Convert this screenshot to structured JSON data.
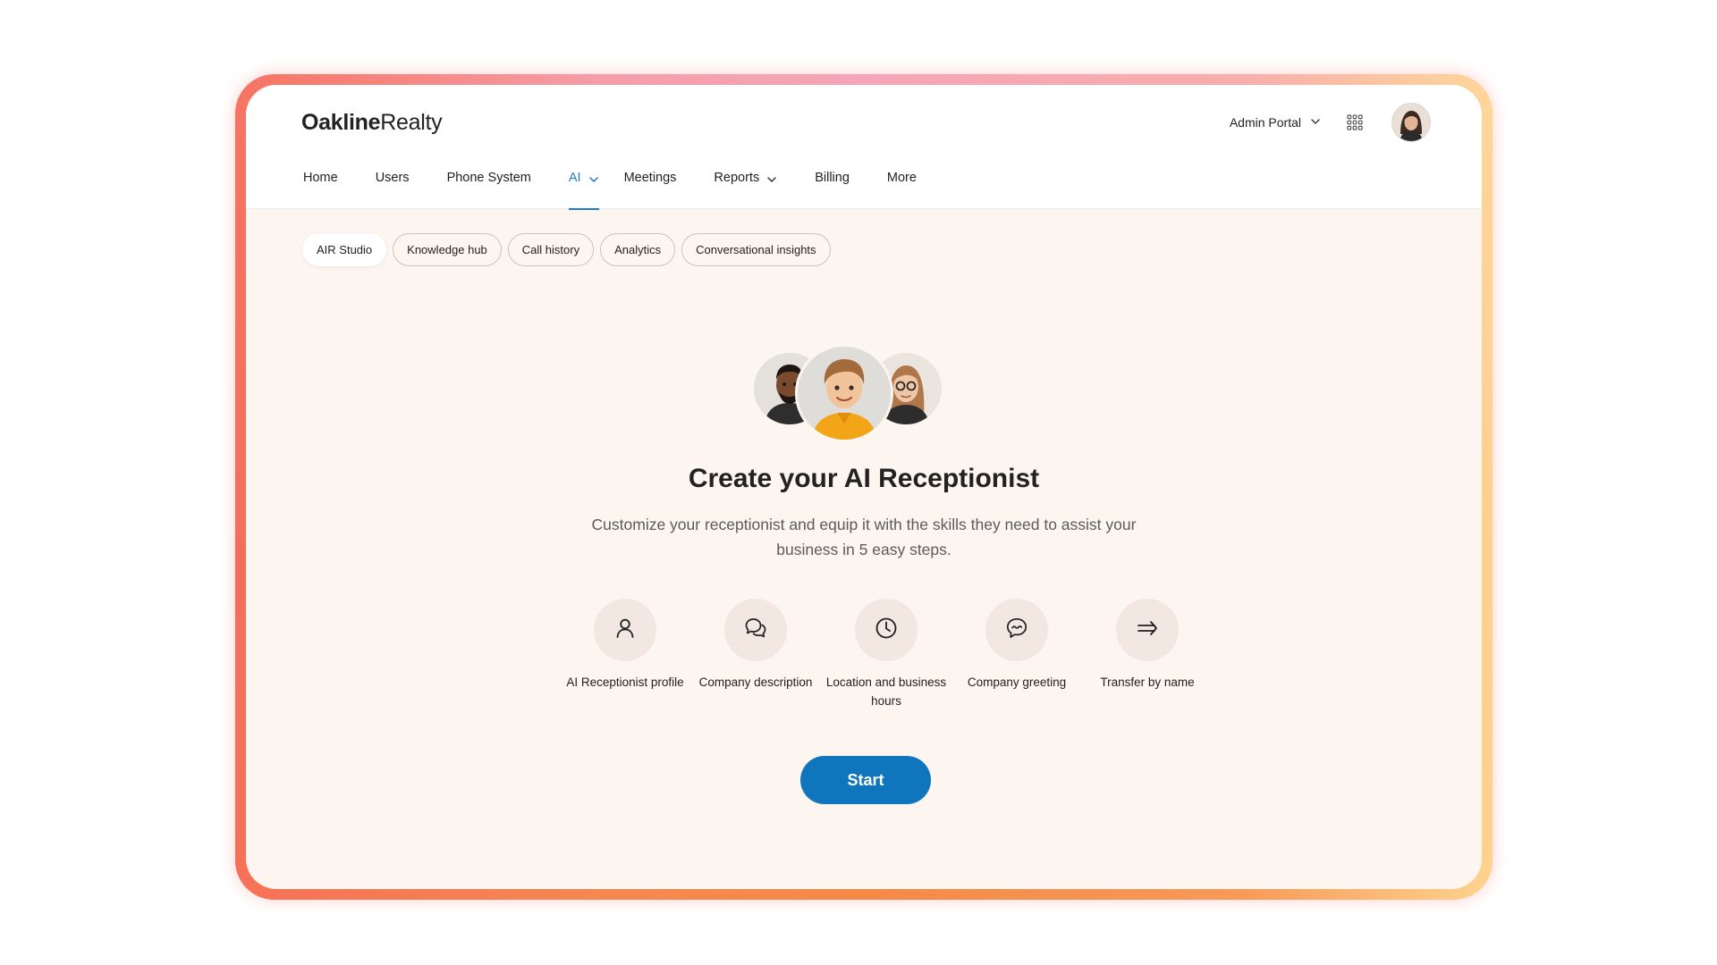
{
  "app": {
    "logo_strong": "Oakline",
    "logo_light": "Realty",
    "portal_label": "Admin Portal"
  },
  "nav": {
    "items": [
      {
        "label": "Home"
      },
      {
        "label": "Users"
      },
      {
        "label": "Phone System"
      },
      {
        "label": "AI",
        "active": true,
        "has_dropdown": true
      },
      {
        "label": "Meetings"
      },
      {
        "label": "Reports",
        "has_dropdown": true
      },
      {
        "label": "Billing"
      },
      {
        "label": "More"
      }
    ]
  },
  "subtabs": [
    {
      "label": "AIR Studio",
      "active": true
    },
    {
      "label": "Knowledge hub"
    },
    {
      "label": "Call history"
    },
    {
      "label": "Analytics"
    },
    {
      "label": "Conversational insights"
    }
  ],
  "hero": {
    "title": "Create your AI Receptionist",
    "subtitle": "Customize your receptionist and equip it with the skills they need to assist your business in 5 easy steps."
  },
  "steps": [
    {
      "icon": "person-icon",
      "label": "AI Receptionist profile"
    },
    {
      "icon": "chat-bubbles-icon",
      "label": "Company description"
    },
    {
      "icon": "clock-icon",
      "label": "Location and business hours"
    },
    {
      "icon": "greeting-bubble-icon",
      "label": "Company greeting"
    },
    {
      "icon": "transfer-arrow-icon",
      "label": "Transfer by name"
    }
  ],
  "actions": {
    "start_label": "Start"
  },
  "colors": {
    "accent": "#1f7cc6",
    "button": "#0f76bd",
    "background": "#fdf5f0"
  }
}
